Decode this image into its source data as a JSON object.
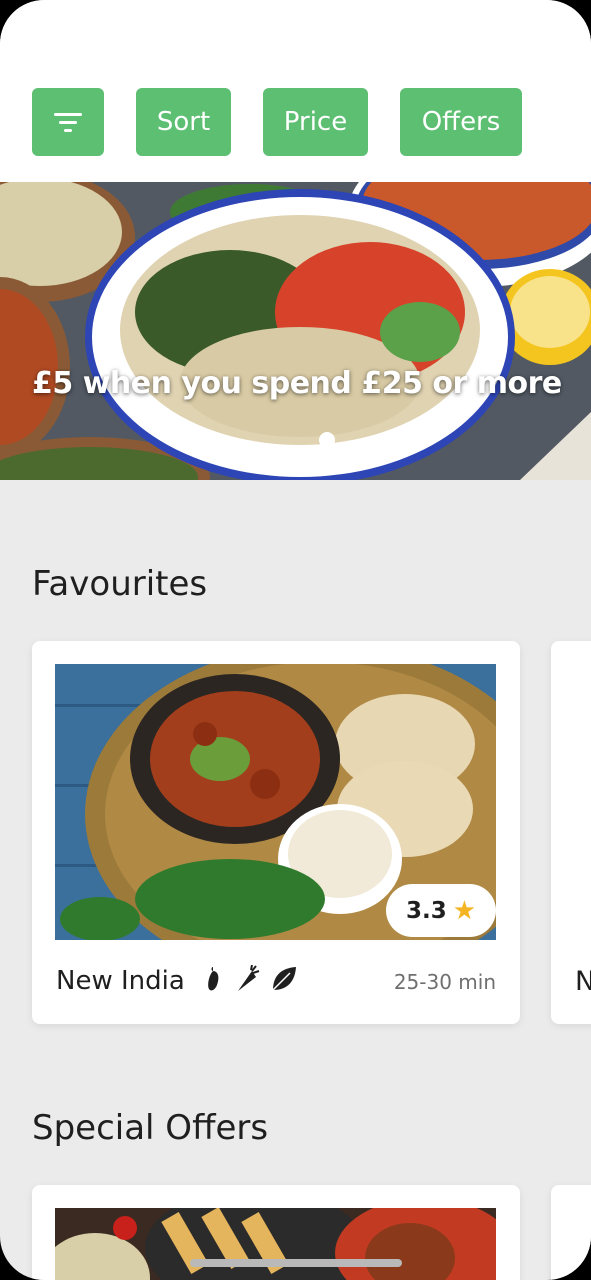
{
  "filters": {
    "filter_icon": "filter-icon",
    "sort_label": "Sort",
    "price_label": "Price",
    "offers_label": "Offers"
  },
  "banner": {
    "text": "£5 when you spend £25 or more",
    "page_indicator": {
      "current": 1,
      "total": 1
    }
  },
  "favourites": {
    "title": "Favourites",
    "cards": [
      {
        "name": "New India",
        "rating": "3.3",
        "time": "25-30 min",
        "icons": [
          "chili-icon",
          "carrot-icon",
          "leaf-icon"
        ]
      }
    ],
    "peek_letter": "N"
  },
  "special_offers": {
    "title": "Special Offers"
  },
  "colors": {
    "accent": "#5cbf72",
    "background": "#ebebeb",
    "star": "#f5b423"
  }
}
